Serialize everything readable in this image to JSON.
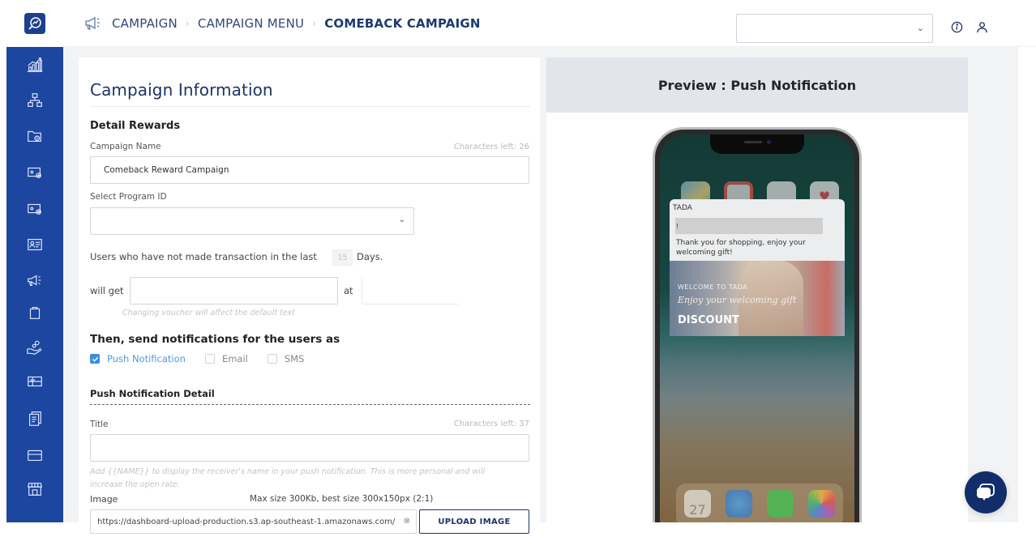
{
  "header": {
    "breadcrumb": [
      {
        "label": "CAMPAIGN",
        "icon": "megaphone-icon"
      },
      {
        "label": "CAMPAIGN MENU"
      },
      {
        "label": "COMEBACK CAMPAIGN"
      }
    ],
    "select_value": "",
    "icons": [
      "info-icon",
      "user-icon"
    ]
  },
  "sidebar": {
    "logo": "search-analytics-logo",
    "items": [
      {
        "icon": "analytics-icon"
      },
      {
        "icon": "hierarchy-icon"
      },
      {
        "icon": "folder-icon"
      },
      {
        "icon": "card-add-icon"
      },
      {
        "icon": "card-settings-icon"
      },
      {
        "icon": "member-card-icon"
      },
      {
        "icon": "megaphone-icon"
      },
      {
        "icon": "shopping-bag-icon"
      },
      {
        "icon": "hand-coin-icon"
      },
      {
        "icon": "gift-card-icon"
      },
      {
        "icon": "documents-icon"
      },
      {
        "icon": "credit-card-icon"
      },
      {
        "icon": "store-icon"
      }
    ]
  },
  "form": {
    "title": "Campaign Information",
    "detail_rewards": "Detail Rewards",
    "campaign_name_label": "Campaign Name",
    "campaign_name_chars_left": "Characters left: 26",
    "campaign_name_value": "Comeback Reward Campaign",
    "program_id_label": "Select Program ID",
    "program_id_value": "",
    "inactive_prefix": "Users who have not made transaction in the last",
    "inactive_days": "15",
    "inactive_suffix": "Days.",
    "will_get_label": "will get",
    "will_get_value": "",
    "at_label": "at",
    "at_value": "",
    "voucher_hint": "Changing voucher will affect the default text",
    "send_title": "Then, send notifications for the users as",
    "channels": [
      {
        "label": "Push Notification",
        "checked": true
      },
      {
        "label": "Email",
        "checked": false
      },
      {
        "label": "SMS",
        "checked": false
      }
    ],
    "push_detail_title": "Push Notification Detail",
    "title_label": "Title",
    "title_chars_left": "Characters left: 37",
    "title_value": "",
    "title_hint": "Add {{NAME}} to display the receiver's name in your push notification. This is more personal and will increase the open rate.",
    "image_label": "Image",
    "image_hint": "Max size 300Kb, best size 300x150px (2:1)",
    "image_url": "https://dashboard-upload-production.s3.ap-southeast-1.amazonaws.com/",
    "upload_button": "UPLOAD IMAGE"
  },
  "preview": {
    "title": "Preview : Push Notification",
    "notification": {
      "app_name": "TADA",
      "title": "!",
      "body": "Thank you for shopping, enjoy your welcoming gift!",
      "image_welcome": "WELCOME TO TADA",
      "image_script": "Enjoy your welcoming gift",
      "image_discount": "DISCOUNT"
    },
    "dock_calendar_day": "27"
  },
  "chat": {
    "icon": "chat-icon"
  },
  "colors": {
    "sidebar": "#1c469f",
    "primary_dark": "#1c3366",
    "checkbox_on": "#3d8de0",
    "chat_button": "#122e6a"
  }
}
